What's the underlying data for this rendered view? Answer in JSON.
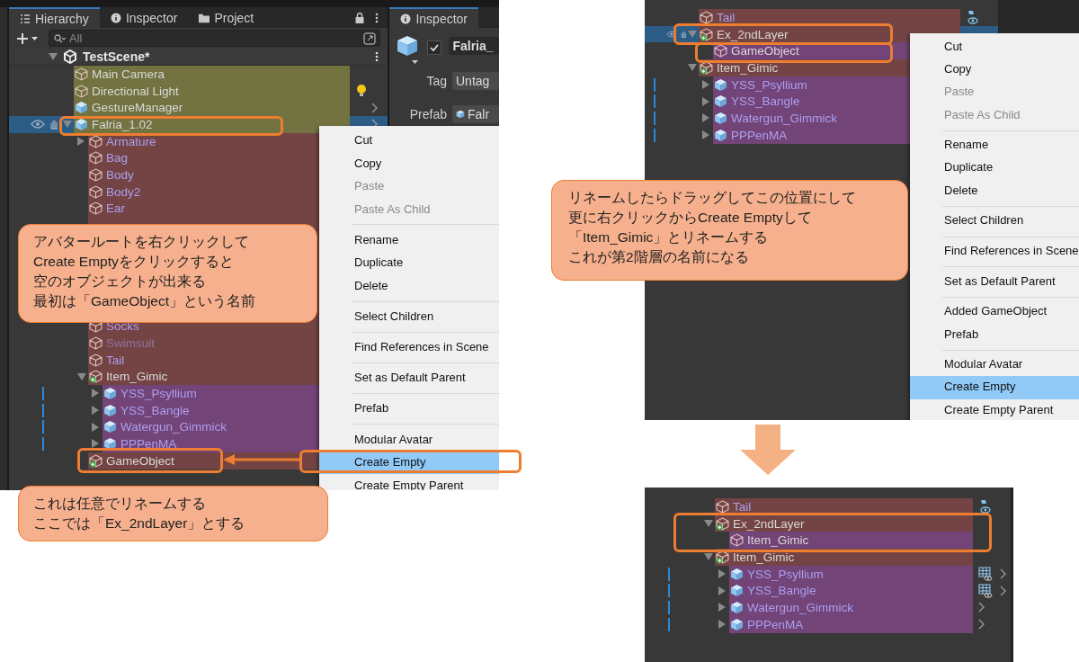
{
  "panels": [
    {
      "kind": "editor",
      "tabs": [
        {
          "label": "Hierarchy",
          "selected": true
        },
        {
          "label": "Inspector",
          "selected": false
        },
        {
          "label": "Project",
          "selected": false
        }
      ],
      "search": {
        "placeholder": "All"
      },
      "scene": "TestScene*",
      "tree": [
        {
          "label": "Main Camera",
          "kind": "object",
          "color": "#737342",
          "selected": false
        },
        {
          "label": "Directional Light",
          "kind": "object",
          "color": "#737342",
          "selected": false
        },
        {
          "label": "GestureManager",
          "kind": "prefab",
          "color": "#737342",
          "selected": false
        },
        {
          "label": "Falria_1.02",
          "kind": "prefab",
          "color": "#737342",
          "selected": true,
          "expanded": true,
          "children": [
            {
              "label": "Armature",
              "kind": "object",
              "color": "#744444",
              "linked": true,
              "selected": false,
              "expanded": false
            },
            {
              "label": "Bag",
              "kind": "object",
              "color": "#744444",
              "linked": true,
              "selected": false
            },
            {
              "label": "Body",
              "kind": "object",
              "color": "#744444",
              "linked": true,
              "selected": false
            },
            {
              "label": "Body2",
              "kind": "object",
              "color": "#744444",
              "linked": true,
              "selected": false
            },
            {
              "label": "Ear",
              "kind": "object",
              "color": "#744444",
              "linked": true,
              "selected": false
            },
            {
              "kind": "covered"
            },
            {
              "kind": "covered"
            },
            {
              "kind": "covered"
            },
            {
              "kind": "covered"
            },
            {
              "kind": "covered"
            },
            {
              "kind": "covered"
            },
            {
              "label": "Socks",
              "kind": "object",
              "color": "#744444",
              "linked": true,
              "selected": false
            },
            {
              "label": "Swimsuit",
              "kind": "object",
              "color": "#744444",
              "linked": true,
              "disabled": true,
              "selected": false
            },
            {
              "label": "Tail",
              "kind": "object",
              "color": "#744444",
              "linked": true,
              "selected": false
            },
            {
              "label": "Item_Gimic",
              "kind": "group",
              "color": "#744444",
              "selected": false,
              "expanded": true,
              "children": [
                {
                  "label": "YSS_Psyllium",
                  "kind": "prefab",
                  "color": "#734477",
                  "linked": true,
                  "marked": true,
                  "selected": false,
                  "expanded": false
                },
                {
                  "label": "YSS_Bangle",
                  "kind": "prefab",
                  "color": "#734477",
                  "linked": true,
                  "marked": true,
                  "selected": false,
                  "expanded": false
                },
                {
                  "label": "Watergun_Gimmick",
                  "kind": "prefab",
                  "color": "#734477",
                  "linked": true,
                  "marked": true,
                  "selected": false,
                  "expanded": false
                },
                {
                  "label": "PPPenMA",
                  "kind": "prefab",
                  "color": "#734477",
                  "linked": true,
                  "marked": true,
                  "selected": false,
                  "expanded": false
                }
              ]
            },
            {
              "label": "GameObject",
              "kind": "group",
              "color": "#744444",
              "selected": false
            }
          ]
        }
      ],
      "inspector": {
        "tab": "Inspector",
        "enabled": true,
        "name": "Falria_",
        "fields": [
          {
            "label": "Tag",
            "value": "Untag"
          },
          {
            "label": "Prefab",
            "value": "Falr"
          }
        ]
      },
      "menu": [
        [
          {
            "label": "Cut",
            "disabled": false,
            "selected": false
          },
          {
            "label": "Copy",
            "disabled": false,
            "selected": false
          },
          {
            "label": "Paste",
            "disabled": true,
            "selected": false
          },
          {
            "label": "Paste As Child",
            "disabled": true,
            "selected": false
          }
        ],
        [
          {
            "label": "Rename",
            "disabled": false,
            "selected": false
          },
          {
            "label": "Duplicate",
            "disabled": false,
            "selected": false
          },
          {
            "label": "Delete",
            "disabled": false,
            "selected": false
          }
        ],
        [
          {
            "label": "Select Children",
            "disabled": false,
            "selected": false
          }
        ],
        [
          {
            "label": "Find References in Scene",
            "disabled": false,
            "selected": false
          }
        ],
        [
          {
            "label": "Set as Default Parent",
            "disabled": false,
            "selected": false
          }
        ],
        [
          {
            "label": "Prefab",
            "disabled": false,
            "selected": false
          }
        ],
        [
          {
            "label": "Modular Avatar",
            "disabled": false,
            "selected": false
          },
          {
            "label": "Create Empty",
            "disabled": false,
            "selected": true
          },
          {
            "label": "Create Empty Parent",
            "disabled": false,
            "selected": false
          }
        ]
      ]
    },
    {
      "kind": "tree-menu",
      "tree": [
        {
          "label": "Tail",
          "kind": "object",
          "color": "#744444",
          "linked": true,
          "selected": false
        },
        {
          "label": "Ex_2ndLayer",
          "kind": "group",
          "color": "#744444",
          "selected": true,
          "expanded": true,
          "children": [
            {
              "label": "GameObject",
              "kind": "object",
              "color": "#734477",
              "selected": false
            }
          ]
        },
        {
          "label": "Item_Gimic",
          "kind": "group",
          "color": "#744444",
          "selected": false,
          "expanded": true,
          "children": [
            {
              "label": "YSS_Psyllium",
              "kind": "prefab",
              "color": "#734477",
              "linked": true,
              "marked": true,
              "selected": false,
              "expanded": false
            },
            {
              "label": "YSS_Bangle",
              "kind": "prefab",
              "color": "#734477",
              "linked": true,
              "marked": true,
              "selected": false,
              "expanded": false
            },
            {
              "label": "Watergun_Gimmick",
              "kind": "prefab",
              "color": "#734477",
              "linked": true,
              "marked": true,
              "selected": false,
              "expanded": false
            },
            {
              "label": "PPPenMA",
              "kind": "prefab",
              "color": "#734477",
              "linked": true,
              "marked": true,
              "selected": false,
              "expanded": false
            }
          ]
        }
      ],
      "menu": [
        [
          {
            "label": "Cut",
            "disabled": false,
            "selected": false
          },
          {
            "label": "Copy",
            "disabled": false,
            "selected": false
          },
          {
            "label": "Paste",
            "disabled": true,
            "selected": false
          },
          {
            "label": "Paste As Child",
            "disabled": true,
            "selected": false
          }
        ],
        [
          {
            "label": "Rename",
            "disabled": false,
            "selected": false
          },
          {
            "label": "Duplicate",
            "disabled": false,
            "selected": false
          },
          {
            "label": "Delete",
            "disabled": false,
            "selected": false
          }
        ],
        [
          {
            "label": "Select Children",
            "disabled": false,
            "selected": false
          }
        ],
        [
          {
            "label": "Find References in Scene",
            "disabled": false,
            "selected": false
          }
        ],
        [
          {
            "label": "Set as Default Parent",
            "disabled": false,
            "selected": false
          }
        ],
        [
          {
            "label": "Added GameObject",
            "disabled": false,
            "selected": false
          },
          {
            "label": "Prefab",
            "disabled": false,
            "selected": false
          }
        ],
        [
          {
            "label": "Modular Avatar",
            "disabled": false,
            "selected": false
          },
          {
            "label": "Create Empty",
            "disabled": false,
            "selected": true
          },
          {
            "label": "Create Empty Parent",
            "disabled": false,
            "selected": false
          }
        ]
      ]
    },
    {
      "kind": "tree",
      "tree": [
        {
          "label": "Tail",
          "kind": "object",
          "color": "#744444",
          "linked": true,
          "selected": false
        },
        {
          "label": "Ex_2ndLayer",
          "kind": "group",
          "color": "#744444",
          "selected": false,
          "expanded": true,
          "children": [
            {
              "label": "Item_Gimic",
              "kind": "object",
              "color": "#734477",
              "selected": false
            }
          ]
        },
        {
          "label": "Item_Gimic",
          "kind": "group",
          "color": "#744444",
          "selected": false,
          "expanded": true,
          "children": [
            {
              "label": "YSS_Psyllium",
              "kind": "prefab",
              "color": "#734477",
              "linked": true,
              "marked": true,
              "selected": false,
              "expanded": false
            },
            {
              "label": "YSS_Bangle",
              "kind": "prefab",
              "color": "#734477",
              "linked": true,
              "marked": true,
              "selected": false,
              "expanded": false
            },
            {
              "label": "Watergun_Gimmick",
              "kind": "prefab",
              "color": "#734477",
              "linked": true,
              "marked": true,
              "selected": false,
              "expanded": false
            },
            {
              "label": "PPPenMA",
              "kind": "prefab",
              "color": "#734477",
              "linked": true,
              "marked": true,
              "selected": false,
              "expanded": false
            }
          ]
        }
      ]
    }
  ],
  "callouts": [
    {
      "lines": [
        "アバタールートを右クリックして",
        "Create Emptyをクリックすると",
        "空のオブジェクトが出来る",
        "最初は「GameObject」という名前"
      ]
    },
    {
      "lines": [
        "これは任意でリネームする",
        "ここでは「Ex_2ndLayer」とする"
      ]
    },
    {
      "lines": [
        "リネームしたらドラッグしてこの位置にして",
        "更に右クリックからCreate Emptyして",
        "「Item_Gimic」とリネームする",
        "これが第2階層の名前になる"
      ]
    }
  ]
}
